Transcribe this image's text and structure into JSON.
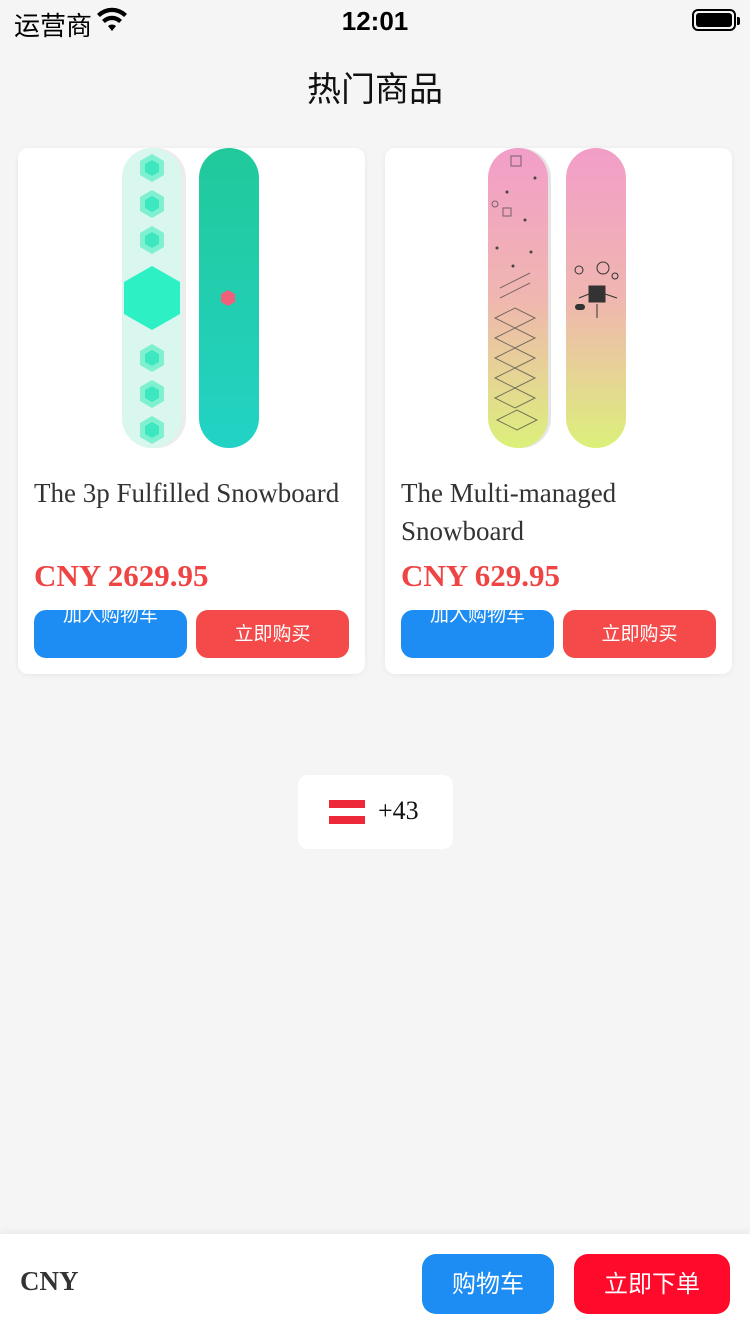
{
  "status_bar": {
    "carrier": "运营商",
    "time": "12:01"
  },
  "page": {
    "title": "热门商品"
  },
  "products": [
    {
      "name": "The 3p Fulfilled Snowboard",
      "price": "CNY 2629.95",
      "add_to_cart_label": "加入购物车",
      "buy_now_label": "立即购买",
      "image_icon": "snowboard-teal-hexagon"
    },
    {
      "name": "The Multi-managed Snowboard",
      "price": "CNY 629.95",
      "add_to_cart_label": "加入购物车",
      "buy_now_label": "立即购买",
      "image_icon": "snowboard-pink-yellow"
    }
  ],
  "country_selector": {
    "flag_icon": "austria-flag",
    "code": "+43"
  },
  "bottom_bar": {
    "currency": "CNY",
    "cart_label": "购物车",
    "order_label": "立即下单"
  },
  "colors": {
    "primary_blue": "#1e8df3",
    "buy_red": "#f44a4a",
    "order_red": "#ff0a2a",
    "price_red": "#ef4444",
    "background": "#f5f5f5"
  }
}
